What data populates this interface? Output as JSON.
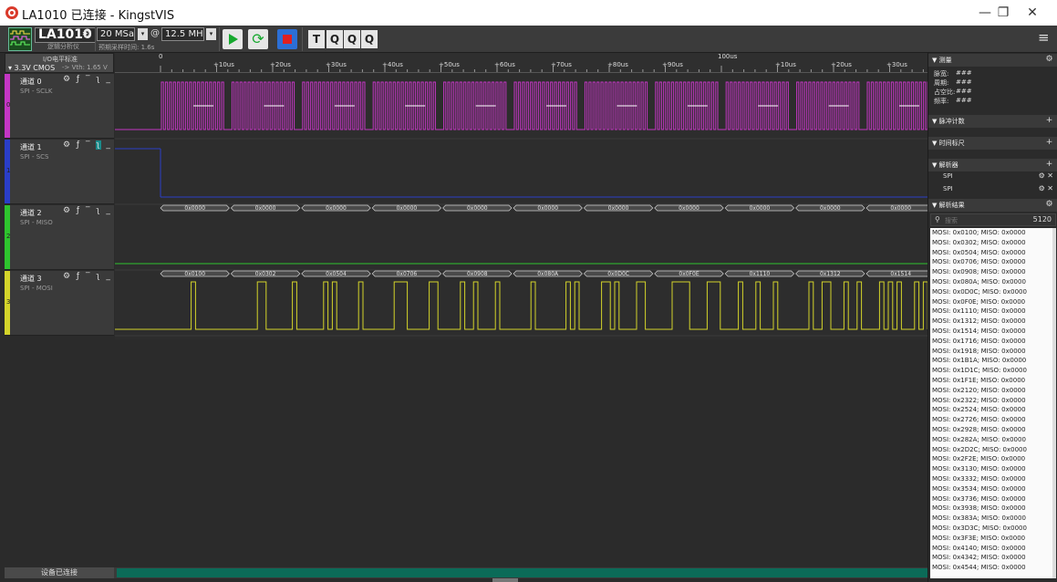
{
  "window": {
    "title": "LA1010 已连接 - KingstVIS",
    "minimize": "—",
    "restore": "❐",
    "close": "✕"
  },
  "toolbar": {
    "device_name": "LA1010",
    "device_sub": "逻辑分析仪",
    "sample_depth": "20 MSa",
    "at": "@",
    "sample_rate": "12.5 MHz",
    "sample_time": "预期采样时间: 1.6s",
    "tools": [
      "T",
      "Q",
      "Q",
      "Q"
    ]
  },
  "io_panel": {
    "title": "I/O电平标准",
    "level": "▾ 3.3V CMOS",
    "vth": "-> Vth: 1.65 V"
  },
  "ruler": {
    "zero": "0",
    "ticks": [
      "+10us",
      "+20us",
      "+30us",
      "+40us",
      "+50us",
      "+60us",
      "+70us",
      "+80us",
      "+90us",
      "+10us",
      "+20us",
      "+30us"
    ],
    "major": "100us"
  },
  "channels": [
    {
      "name": "通道 0",
      "signal": "SPI - SCLK",
      "num": "0",
      "color": "#c436c4"
    },
    {
      "name": "通道 1",
      "signal": "SPI - SCS",
      "num": "1",
      "color": "#2a3ec8"
    },
    {
      "name": "通道 2",
      "signal": "SPI - MISO",
      "num": "2",
      "color": "#2ec42e"
    },
    {
      "name": "通道 3",
      "signal": "SPI - MOSI",
      "num": "3",
      "color": "#d4d42a"
    }
  ],
  "miso_labels": [
    "0x0000",
    "0x0000",
    "0x0000",
    "0x0000",
    "0x0000",
    "0x0000",
    "0x0000",
    "0x0000",
    "0x0000",
    "0x0000",
    "0x0000"
  ],
  "mosi_labels": [
    "0x0100",
    "0x0302",
    "0x0504",
    "0x0706",
    "0x0908",
    "0x080A",
    "0x0D0C",
    "0x0F0E",
    "0x1110",
    "0x1312",
    "0x1514"
  ],
  "status": "设备已连接",
  "right_panel": {
    "measure": {
      "title": "▼ 测量",
      "rows": [
        {
          "label": "脉宽:",
          "value": "###"
        },
        {
          "label": "周期:",
          "value": "###"
        },
        {
          "label": "占空比:",
          "value": "###"
        },
        {
          "label": "频率:",
          "value": "###"
        }
      ]
    },
    "pulse_count": "▼ 脉冲计数",
    "time_ruler": "▼ 时间标尺",
    "decoders": {
      "title": "▼ 解析器",
      "items": [
        "SPI",
        "SPI"
      ]
    },
    "results": {
      "title": "▼ 解析结果",
      "search_placeholder": "搜索",
      "count": "5120",
      "rows": [
        "MOSI: 0x0100;  MISO: 0x0000",
        "MOSI: 0x0302;  MISO: 0x0000",
        "MOSI: 0x0504;  MISO: 0x0000",
        "MOSI: 0x0706;  MISO: 0x0000",
        "MOSI: 0x0908;  MISO: 0x0000",
        "MOSI: 0x080A;  MISO: 0x0000",
        "MOSI: 0x0D0C;  MISO: 0x0000",
        "MOSI: 0x0F0E;  MISO: 0x0000",
        "MOSI: 0x1110;  MISO: 0x0000",
        "MOSI: 0x1312;  MISO: 0x0000",
        "MOSI: 0x1514;  MISO: 0x0000",
        "MOSI: 0x1716;  MISO: 0x0000",
        "MOSI: 0x1918;  MISO: 0x0000",
        "MOSI: 0x1B1A;  MISO: 0x0000",
        "MOSI: 0x1D1C;  MISO: 0x0000",
        "MOSI: 0x1F1E;  MISO: 0x0000",
        "MOSI: 0x2120;  MISO: 0x0000",
        "MOSI: 0x2322;  MISO: 0x0000",
        "MOSI: 0x2524;  MISO: 0x0000",
        "MOSI: 0x2726;  MISO: 0x0000",
        "MOSI: 0x2928;  MISO: 0x0000",
        "MOSI: 0x282A;  MISO: 0x0000",
        "MOSI: 0x2D2C;  MISO: 0x0000",
        "MOSI: 0x2F2E;  MISO: 0x0000",
        "MOSI: 0x3130;  MISO: 0x0000",
        "MOSI: 0x3332;  MISO: 0x0000",
        "MOSI: 0x3534;  MISO: 0x0000",
        "MOSI: 0x3736;  MISO: 0x0000",
        "MOSI: 0x3938;  MISO: 0x0000",
        "MOSI: 0x383A;  MISO: 0x0000",
        "MOSI: 0x3D3C;  MISO: 0x0000",
        "MOSI: 0x3F3E;  MISO: 0x0000",
        "MOSI: 0x4140;  MISO: 0x0000",
        "MOSI: 0x4342;  MISO: 0x0000",
        "MOSI: 0x4544;  MISO: 0x0000"
      ]
    }
  }
}
